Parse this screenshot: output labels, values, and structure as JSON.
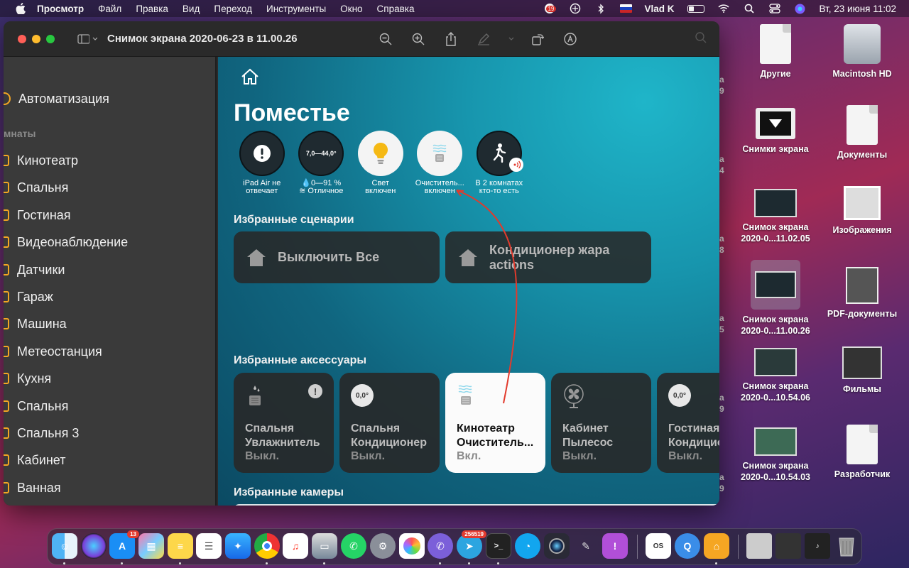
{
  "menubar": {
    "app_name": "Просмотр",
    "items": [
      "Файл",
      "Правка",
      "Вид",
      "Переход",
      "Инструменты",
      "Окно",
      "Справка"
    ],
    "user": "Vlad K",
    "datetime": "Вт, 23 июня  11:02",
    "status_badge": "19"
  },
  "window": {
    "title": "Снимок экрана 2020-06-23 в 11.00.26"
  },
  "sidebar": {
    "automation": "Автоматизация",
    "section_rooms": "мнаты",
    "rooms": [
      "Кинотеатр",
      "Спальня",
      "Гостиная",
      "Видеонаблюдение",
      "Датчики",
      "Гараж",
      "Машина",
      "Метеостанция",
      "Кухня",
      "Спальня",
      "Спальня 3",
      "Кабинет",
      "Ванная"
    ]
  },
  "home": {
    "title": "Поместье",
    "status": [
      {
        "line1": "iPad Air не",
        "line2": "отвечает",
        "icon": "exclamation-icon"
      },
      {
        "range": "7,0—44,0°",
        "line1": "💧0—91 %",
        "line2": "≋ Отличное",
        "icon": "climate-range-icon"
      },
      {
        "line1": "Свет",
        "line2": "включен",
        "icon": "bulb-icon"
      },
      {
        "line1": "Очиститель...",
        "line2": "включен",
        "icon": "purifier-icon"
      },
      {
        "line1": "В 2 комнатах",
        "line2": "кто-то есть",
        "icon": "motion-person-icon"
      }
    ],
    "favorite_scenes_title": "Избранные сценарии",
    "scenes": [
      {
        "line1": "Выключить Все",
        "line2": ""
      },
      {
        "line1": "Кондиционер жара",
        "line2": "actions"
      }
    ],
    "favorite_accessories_title": "Избранные аксессуары",
    "accessories": [
      {
        "line1": "Спальня",
        "line2": "Увлажнитель",
        "state": "Выкл.",
        "icon": "humidifier-icon"
      },
      {
        "line1": "Спальня",
        "line2": "Кондиционер",
        "state": "Выкл.",
        "icon": "thermostat-icon",
        "dial": "0,0°"
      },
      {
        "line1": "Кинотеатр",
        "line2": "Очиститель...",
        "state": "Вкл.",
        "icon": "purifier-icon"
      },
      {
        "line1": "Кабинет",
        "line2": "Пылесос",
        "state": "Выкл.",
        "icon": "fan-icon"
      },
      {
        "line1": "Гостиная",
        "line2": "Кондицио",
        "state": "Выкл.",
        "icon": "thermostat-icon",
        "dial": "0,0°"
      }
    ],
    "favorite_cameras_title": "Избранные камеры"
  },
  "desktop": {
    "icons": [
      {
        "line1": "Другие",
        "line2": ""
      },
      {
        "line1": "Macintosh HD",
        "line2": ""
      },
      {
        "line1": "Снимки экрана",
        "line2": ""
      },
      {
        "line1": "Документы",
        "line2": ""
      },
      {
        "line1": "Снимок экрана",
        "line2": "2020-0...11.02.05"
      },
      {
        "line1": "Изображения",
        "line2": ""
      },
      {
        "line1": "Снимок экрана",
        "line2": "2020-0...11.00.26"
      },
      {
        "line1": "PDF-документы",
        "line2": ""
      },
      {
        "line1": "Снимок экрана",
        "line2": "2020-0...10.54.06"
      },
      {
        "line1": "Фильмы",
        "line2": ""
      },
      {
        "line1": "Снимок экрана",
        "line2": "2020-0...10.54.03"
      },
      {
        "line1": "Разработчик",
        "line2": ""
      }
    ],
    "partial_captions": [
      "а",
      "9",
      "а",
      "4",
      "а",
      "8",
      "а",
      "5",
      "а",
      "9",
      "а",
      "9"
    ]
  },
  "dock": {
    "badges": {
      "app_store": "13",
      "telegram": "256519"
    },
    "colors": {
      "accent": "#1fb5c9",
      "warning": "#f5a623",
      "arrow": "#e23a2c"
    }
  }
}
